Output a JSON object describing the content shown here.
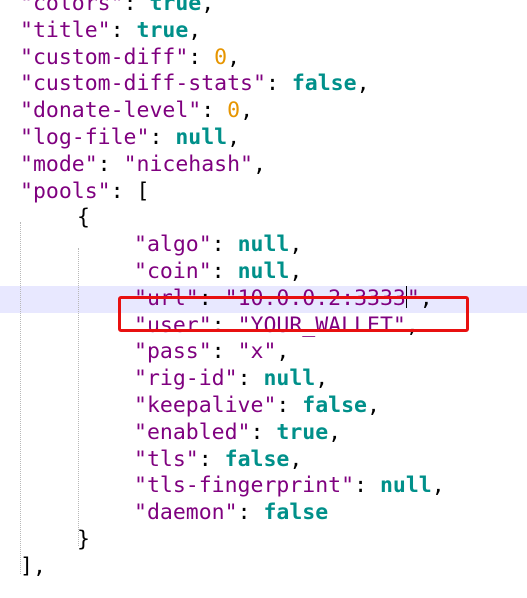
{
  "editor": {
    "current_line_index": 11,
    "lines": [
      {
        "indent": 0,
        "tokens": [
          {
            "t": "key",
            "v": "\"colors\""
          },
          {
            "t": "punct",
            "v": ": "
          },
          {
            "t": "bool",
            "v": "true"
          },
          {
            "t": "punct",
            "v": ","
          }
        ]
      },
      {
        "indent": 0,
        "tokens": [
          {
            "t": "key",
            "v": "\"title\""
          },
          {
            "t": "punct",
            "v": ": "
          },
          {
            "t": "bool",
            "v": "true"
          },
          {
            "t": "punct",
            "v": ","
          }
        ]
      },
      {
        "indent": 0,
        "tokens": [
          {
            "t": "key",
            "v": "\"custom-diff\""
          },
          {
            "t": "punct",
            "v": ": "
          },
          {
            "t": "num",
            "v": "0"
          },
          {
            "t": "punct",
            "v": ","
          }
        ]
      },
      {
        "indent": 0,
        "tokens": [
          {
            "t": "key",
            "v": "\"custom-diff-stats\""
          },
          {
            "t": "punct",
            "v": ": "
          },
          {
            "t": "bool",
            "v": "false"
          },
          {
            "t": "punct",
            "v": ","
          }
        ]
      },
      {
        "indent": 0,
        "tokens": [
          {
            "t": "key",
            "v": "\"donate-level\""
          },
          {
            "t": "punct",
            "v": ": "
          },
          {
            "t": "num",
            "v": "0"
          },
          {
            "t": "punct",
            "v": ","
          }
        ]
      },
      {
        "indent": 0,
        "tokens": [
          {
            "t": "key",
            "v": "\"log-file\""
          },
          {
            "t": "punct",
            "v": ": "
          },
          {
            "t": "null",
            "v": "null"
          },
          {
            "t": "punct",
            "v": ","
          }
        ]
      },
      {
        "indent": 0,
        "tokens": [
          {
            "t": "key",
            "v": "\"mode\""
          },
          {
            "t": "punct",
            "v": ": "
          },
          {
            "t": "str",
            "v": "\"nicehash\""
          },
          {
            "t": "punct",
            "v": ","
          }
        ]
      },
      {
        "indent": 0,
        "tokens": [
          {
            "t": "key",
            "v": "\"pools\""
          },
          {
            "t": "punct",
            "v": ": ["
          }
        ]
      },
      {
        "indent": 1,
        "tokens": [
          {
            "t": "punct",
            "v": "{"
          }
        ]
      },
      {
        "indent": 2,
        "tokens": [
          {
            "t": "key",
            "v": "\"algo\""
          },
          {
            "t": "punct",
            "v": ": "
          },
          {
            "t": "null",
            "v": "null"
          },
          {
            "t": "punct",
            "v": ","
          }
        ]
      },
      {
        "indent": 2,
        "tokens": [
          {
            "t": "key",
            "v": "\"coin\""
          },
          {
            "t": "punct",
            "v": ": "
          },
          {
            "t": "null",
            "v": "null"
          },
          {
            "t": "punct",
            "v": ","
          }
        ]
      },
      {
        "indent": 2,
        "tokens": [
          {
            "t": "key",
            "v": "\"url\""
          },
          {
            "t": "punct",
            "v": ": "
          },
          {
            "t": "str",
            "v": "\"10.0.0.2:3333"
          },
          {
            "t": "caret",
            "v": ""
          },
          {
            "t": "str",
            "v": "\""
          },
          {
            "t": "punct",
            "v": ","
          }
        ]
      },
      {
        "indent": 2,
        "tokens": [
          {
            "t": "key",
            "v": "\"user\""
          },
          {
            "t": "punct",
            "v": ": "
          },
          {
            "t": "str",
            "v": "\"YOUR_WALLET\""
          },
          {
            "t": "punct",
            "v": ","
          }
        ]
      },
      {
        "indent": 2,
        "tokens": [
          {
            "t": "key",
            "v": "\"pass\""
          },
          {
            "t": "punct",
            "v": ": "
          },
          {
            "t": "str",
            "v": "\"x\""
          },
          {
            "t": "punct",
            "v": ","
          }
        ]
      },
      {
        "indent": 2,
        "tokens": [
          {
            "t": "key",
            "v": "\"rig-id\""
          },
          {
            "t": "punct",
            "v": ": "
          },
          {
            "t": "null",
            "v": "null"
          },
          {
            "t": "punct",
            "v": ","
          }
        ]
      },
      {
        "indent": 2,
        "tokens": [
          {
            "t": "key",
            "v": "\"keepalive\""
          },
          {
            "t": "punct",
            "v": ": "
          },
          {
            "t": "bool",
            "v": "false"
          },
          {
            "t": "punct",
            "v": ","
          }
        ]
      },
      {
        "indent": 2,
        "tokens": [
          {
            "t": "key",
            "v": "\"enabled\""
          },
          {
            "t": "punct",
            "v": ": "
          },
          {
            "t": "bool",
            "v": "true"
          },
          {
            "t": "punct",
            "v": ","
          }
        ]
      },
      {
        "indent": 2,
        "tokens": [
          {
            "t": "key",
            "v": "\"tls\""
          },
          {
            "t": "punct",
            "v": ": "
          },
          {
            "t": "bool",
            "v": "false"
          },
          {
            "t": "punct",
            "v": ","
          }
        ]
      },
      {
        "indent": 2,
        "tokens": [
          {
            "t": "key",
            "v": "\"tls-fingerprint\""
          },
          {
            "t": "punct",
            "v": ": "
          },
          {
            "t": "null",
            "v": "null"
          },
          {
            "t": "punct",
            "v": ","
          }
        ]
      },
      {
        "indent": 2,
        "tokens": [
          {
            "t": "key",
            "v": "\"daemon\""
          },
          {
            "t": "punct",
            "v": ": "
          },
          {
            "t": "bool",
            "v": "false"
          }
        ]
      },
      {
        "indent": 1,
        "tokens": [
          {
            "t": "punct",
            "v": "}"
          }
        ]
      },
      {
        "indent": 0,
        "tokens": [
          {
            "t": "punct",
            "v": "],"
          }
        ]
      }
    ]
  },
  "colors": {
    "key": "#7f007f",
    "string": "#7f007f",
    "keyword": "#00908a",
    "number": "#e69500",
    "current_line": "#e8e8ff",
    "highlight_box": "#e81010"
  }
}
